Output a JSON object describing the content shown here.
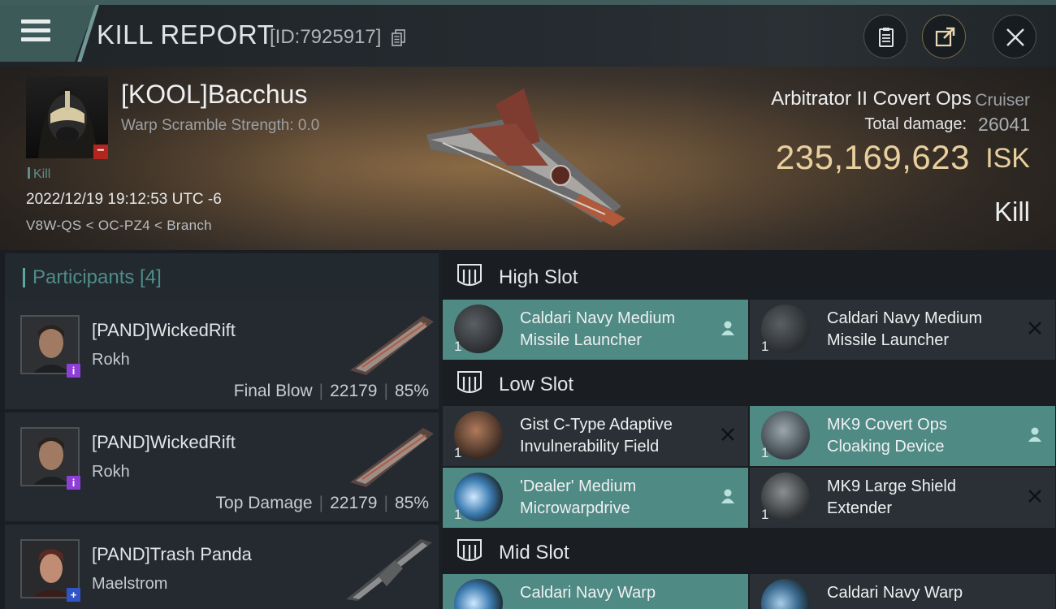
{
  "header": {
    "title": "KILL REPORT",
    "report_id": "[ID:7925917]"
  },
  "victim": {
    "name": "[KOOL]Bacchus",
    "warp_scramble": "Warp Scramble Strength: 0.0",
    "kill_tag": "Kill",
    "datetime": "2022/12/19 19:12:53 UTC -6",
    "location": "V8W-QS < OC-PZ4 < Branch",
    "ship_name": "Arbitrator II Covert Ops",
    "ship_class": "Cruiser",
    "total_damage_label": "Total damage:",
    "total_damage": "26041",
    "isk_value": "235,169,623",
    "isk_unit": "ISK",
    "result": "Kill"
  },
  "participants": {
    "title": "Participants [4]",
    "rows": [
      {
        "name": "[PAND]WickedRift",
        "ship": "Rokh",
        "role": "Final Blow",
        "damage": "22179",
        "percent": "85%"
      },
      {
        "name": "[PAND]WickedRift",
        "ship": "Rokh",
        "role": "Top Damage",
        "damage": "22179",
        "percent": "85%"
      },
      {
        "name": "[PAND]Trash Panda",
        "ship": "Maelstrom"
      }
    ]
  },
  "fitting": {
    "high_slot": "High Slot",
    "low_slot": "Low Slot",
    "mid_slot": "Mid Slot",
    "high": [
      {
        "name": "Caldari Navy Medium Missile Launcher",
        "qty": "1",
        "state": "dropped"
      },
      {
        "name": "Caldari Navy Medium Missile Launcher",
        "qty": "1",
        "state": "destroyed"
      }
    ],
    "low": [
      {
        "name": "Gist C-Type Adaptive Invulnerability Field",
        "qty": "1",
        "state": "destroyed"
      },
      {
        "name": "MK9 Covert Ops Cloaking Device",
        "qty": "1",
        "state": "dropped"
      },
      {
        "name": "'Dealer' Medium Microwarpdrive",
        "qty": "1",
        "state": "dropped"
      },
      {
        "name": "MK9 Large Shield Extender",
        "qty": "1",
        "state": "destroyed"
      }
    ],
    "mid": [
      {
        "name": "Caldari Navy Warp",
        "state": "dropped"
      },
      {
        "name": "Caldari Navy Warp",
        "state": "destroyed"
      }
    ]
  },
  "colors": {
    "accent_teal": "#4f8a84",
    "isk_gold": "#e8cf9d",
    "victim_minus": "#b3261e",
    "badge_purple": "#8e3fd6",
    "badge_blue": "#2f55c8"
  }
}
